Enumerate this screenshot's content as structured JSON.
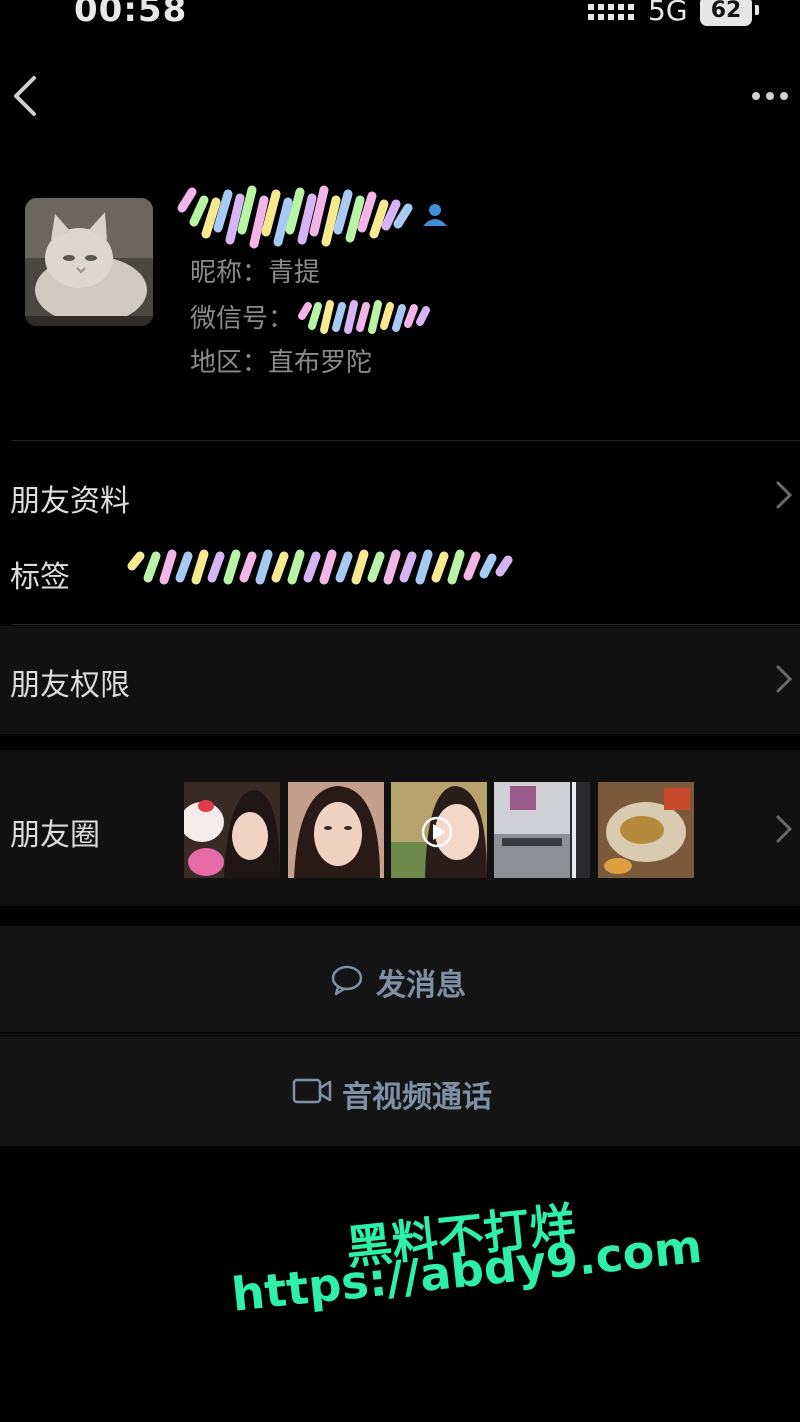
{
  "status_bar": {
    "time": "00:58",
    "network": "5G",
    "battery": "62"
  },
  "nav": {
    "back_icon": "chevron-left-icon",
    "more_icon": "more-dots-icon"
  },
  "profile": {
    "avatar_icon": "cat-avatar-image",
    "nickname": "昵称：青提",
    "wechat_id_label": "微信号：",
    "region": "地区：直布罗陀"
  },
  "rows": {
    "friend_profile": "朋友资料",
    "tags": "标签",
    "friend_permissions": "朋友权限",
    "moments": "朋友圈"
  },
  "actions": {
    "send_message": "发消息",
    "video_call": "音视频通话"
  },
  "watermark": {
    "line1": "黑料不打烊",
    "line2": "https://abdy9.com"
  },
  "colors": {
    "background": "#000000",
    "section": "#111111",
    "action_text": "#7e8fa8",
    "watermark": "#2ef0a8"
  }
}
